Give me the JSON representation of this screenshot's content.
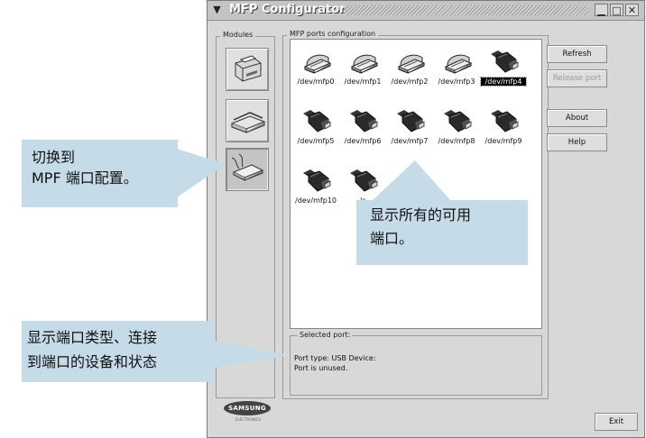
{
  "window": {
    "title": "MFP Configurator",
    "controls": {
      "minimize": "▁",
      "maximize": "□",
      "close": "✕"
    }
  },
  "modules": {
    "label": "Modules",
    "items": [
      {
        "icon": "printer-icon"
      },
      {
        "icon": "scanner-icon"
      },
      {
        "icon": "port-config-icon"
      }
    ]
  },
  "ports": {
    "label": "MFP ports configuration",
    "items": [
      {
        "label": "/dev/mfp0",
        "type": "parallel"
      },
      {
        "label": "/dev/mfp1",
        "type": "parallel"
      },
      {
        "label": "/dev/mfp2",
        "type": "parallel"
      },
      {
        "label": "/dev/mfp3",
        "type": "parallel"
      },
      {
        "label": "/dev/mfp4",
        "type": "usb",
        "selected": true
      },
      {
        "label": "/dev/mfp5",
        "type": "usb"
      },
      {
        "label": "/dev/mfp6",
        "type": "usb"
      },
      {
        "label": "/dev/mfp7",
        "type": "usb"
      },
      {
        "label": "/dev/mfp8",
        "type": "usb"
      },
      {
        "label": "/dev/mfp9",
        "type": "usb"
      },
      {
        "label": "/dev/mfp10",
        "type": "usb"
      },
      {
        "label": "/c",
        "type": "usb"
      }
    ]
  },
  "buttons": {
    "refresh": "Refresh",
    "release_port": "Release port",
    "about": "About",
    "help": "Help",
    "exit": "Exit"
  },
  "selected_port": {
    "label": "Selected port:",
    "type_line": "Port type: USB   Device:",
    "status_line": "Port is unused."
  },
  "logo": {
    "brand": "SAMSUNG",
    "sub": "ELECTRONICS"
  },
  "callouts": {
    "switch": [
      "切换到",
      "MPF 端口配置。"
    ],
    "show_ports": [
      "显示所有的可用",
      "端口。"
    ],
    "port_info": [
      "显示端口类型、连接",
      "到端口的设备和状态"
    ]
  },
  "colors": {
    "callout": "#c5dbe8",
    "window": "#d8d8d8"
  }
}
